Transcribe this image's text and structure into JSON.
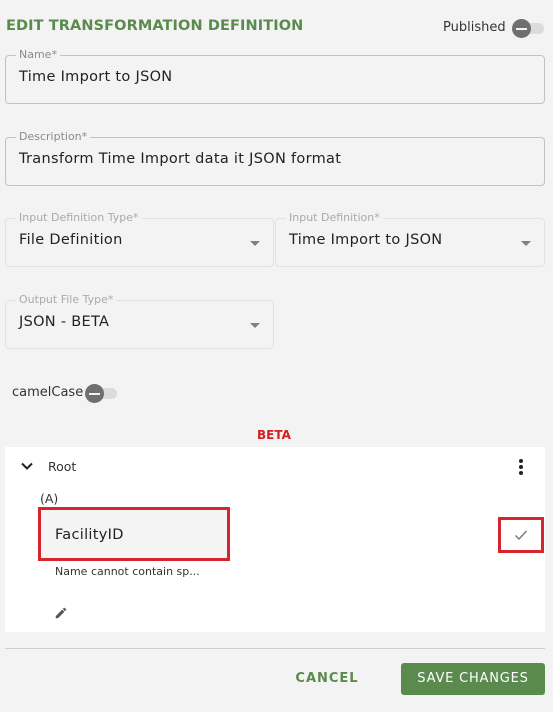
{
  "header": {
    "title": "EDIT TRANSFORMATION DEFINITION",
    "published_label": "Published",
    "published_on": false
  },
  "form": {
    "name": {
      "label": "Name*",
      "value": "Time Import to JSON"
    },
    "description": {
      "label": "Description*",
      "value": "Transform Time Import data it JSON format"
    },
    "input_definition_type": {
      "label": "Input Definition Type*",
      "value": "File Definition"
    },
    "input_definition": {
      "label": "Input Definition*",
      "value": "Time Import to JSON"
    },
    "output_file_type": {
      "label": "Output File Type*",
      "value": "JSON - BETA"
    },
    "camelcase_label": "camelCase",
    "camelcase_on": false
  },
  "tree": {
    "beta_label": "BETA",
    "root_label": "Root",
    "node_tag": "(A)",
    "node_name_value": "FacilityID",
    "node_error": "Name cannot contain sp..."
  },
  "actions": {
    "cancel_label": "CANCEL",
    "save_label": "SAVE CHANGES"
  },
  "colors": {
    "accent_green": "#5b8a4e",
    "beta_red": "#d32020",
    "highlight_red": "#d8242f"
  }
}
